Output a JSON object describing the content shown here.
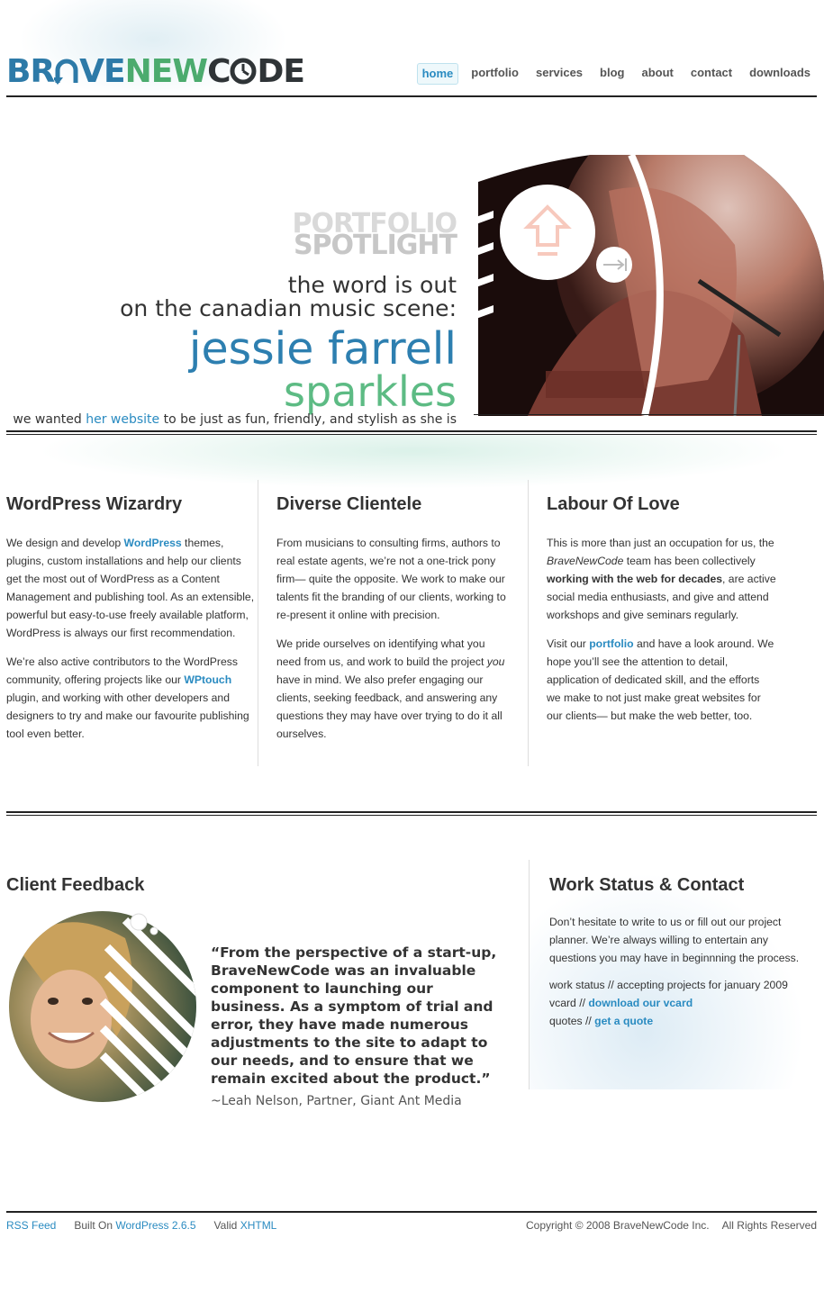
{
  "header": {
    "logo": {
      "part1": "BR",
      "part2": "VE",
      "part3": "NEW",
      "part4": "C",
      "part5": "DE"
    },
    "nav": [
      {
        "label": "home",
        "active": true
      },
      {
        "label": "portfolio"
      },
      {
        "label": "services"
      },
      {
        "label": "blog"
      },
      {
        "label": "about"
      },
      {
        "label": "contact"
      },
      {
        "label": "downloads"
      }
    ]
  },
  "hero": {
    "spotlight_line1": "PORTFOLIO",
    "spotlight_line2": "SPOTLIGHT",
    "line1": "the word is out",
    "line2": "on the canadian music scene:",
    "name": "jessie farrell",
    "tag_word": "sparkles",
    "tagline_before": "we wanted ",
    "tagline_link": "her website",
    "tagline_after": " to be just as fun, friendly, and stylish as she is"
  },
  "columns": [
    {
      "title": "WordPress Wizardry",
      "p1_a": "We design and develop ",
      "p1_link": "WordPress",
      "p1_b": " themes, plugins, custom installations and help our clients get the most out of WordPress as a Content Management and publishing tool. As an extensible, powerful but easy-to-use freely available platform, WordPress is always our first recommendation.",
      "p2_a": "We’re also active contributors to the WordPress community, offering projects like our ",
      "p2_link": "WPtouch",
      "p2_b": " plugin, and working with other developers and designers to try and make our favourite publishing tool even better."
    },
    {
      "title": "Diverse Clientele",
      "p1": "From musicians to consulting firms, authors to real estate agents, we’re not a one-trick pony firm— quite the opposite. We work to make our talents fit the branding of our clients, working to re-present it online with precision.",
      "p2_a": "We pride ourselves on identifying what you need from us, and work to build the project ",
      "p2_em": "you",
      "p2_b": " have in mind. We also prefer engaging our clients, seeking feedback, and answering any questions they may have over trying to do it all ourselves."
    },
    {
      "title": "Labour Of Love",
      "p1_a": "This is more than just an occupation for us, the ",
      "p1_em": "BraveNewCode",
      "p1_b": " team has been collectively ",
      "p1_strong": "working with the web for decades",
      "p1_c": ", are active social media enthusiasts, and give and attend workshops and give seminars regularly.",
      "p2_a": "Visit our ",
      "p2_link": "portfolio",
      "p2_b": " and have a look around. We hope you’ll see the attention to detail, application of dedicated skill, and the efforts we make to not just make great websites for our clients— but make the web better, too."
    }
  ],
  "feedback": {
    "title": "Client Feedback",
    "quote": "“From the perspective of a start-up, BraveNewCode was an invaluable component to launching our business. As a symptom of trial and error, they have made numerous adjustments to the site to adapt to our needs, and to ensure that we remain excited about the product.”",
    "attribution": "~Leah Nelson, Partner, Giant Ant Media"
  },
  "status": {
    "title": "Work Status & Contact",
    "intro": "Don’t hesitate to write to us or fill out our project planner. We’re always willing to entertain any questions you may have in beginnning the process.",
    "work_status": "work status // accepting projects for january 2009",
    "vcard_label": "vcard // ",
    "vcard_link": "download our vcard",
    "quotes_label": "quotes // ",
    "quotes_link": "get a quote"
  },
  "footer": {
    "rss": "RSS Feed",
    "built_on": "Built On ",
    "wordpress": "WordPress 2.6.5",
    "valid": "Valid ",
    "xhtml": "XHTML",
    "copyright": "Copyright © 2008 BraveNewCode Inc.",
    "rights": "All Rights Reserved"
  },
  "colors": {
    "accent_blue": "#2a8bc1",
    "accent_green": "#5dbb84",
    "text": "#333333"
  }
}
